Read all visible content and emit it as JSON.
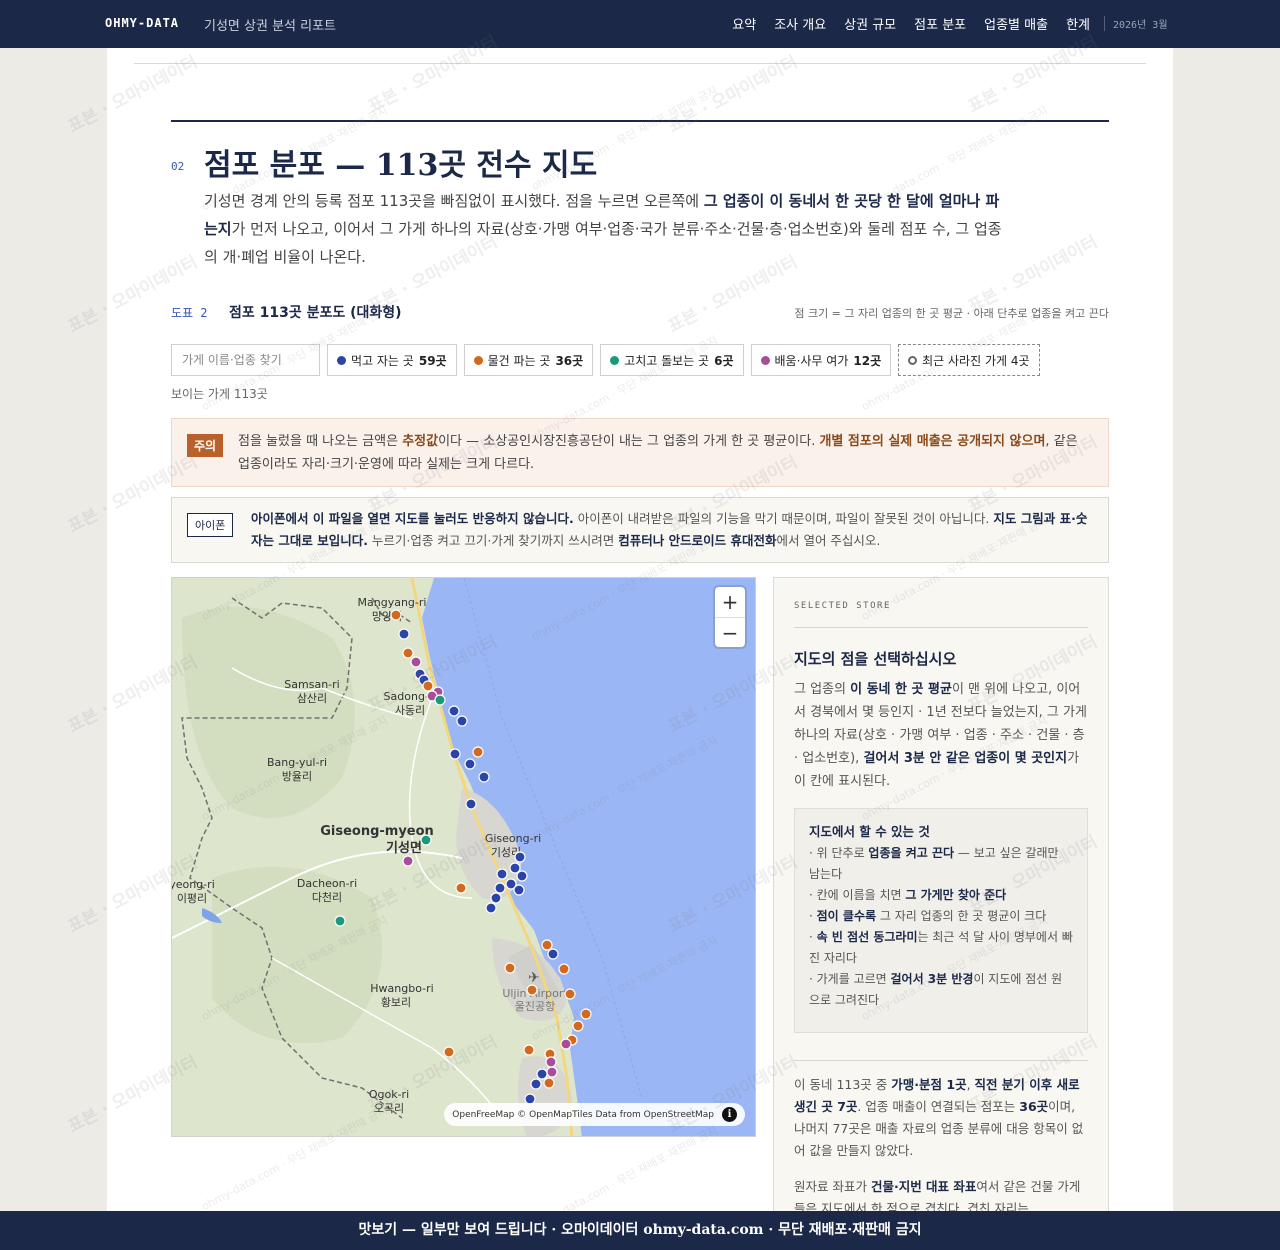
{
  "header": {
    "brand": "OHMY-DATA",
    "subtitle": "기성면 상권 분석 리포트",
    "nav": [
      "요약",
      "조사 개요",
      "상권 규모",
      "점포 분포",
      "업종별 매출",
      "한계"
    ],
    "date": "2026년 3월"
  },
  "section": {
    "number": "02",
    "title": "점포 분포 — 113곳 전수 지도",
    "lead_1": "기성면 경계 안의 등록 점포 113곳을 빠짐없이 표시했다. 점을 누르면 오른쪽에 ",
    "lead_b1": "그 업종이 이 동네서 한 곳당 한 달에 얼마나 파는지",
    "lead_2": "가 먼저 나오고, 이어서 그 가게 하나의 자료(상호·가맹 여부·업종·국가 분류·주소·건물·층·업소번호)와 둘레 점포 수, 그 업종의 개·폐업 비율이 나온다."
  },
  "figure": {
    "label": "도표 2",
    "title": "점포 113곳 분포도 (대화형)",
    "note": "점 크기 = 그 자리 업종의 한 곳 평균 · 아래 단추로 업종을 켜고 끈다",
    "search_placeholder": "가게 이름·업종 찾기",
    "filters": [
      {
        "label": "먹고 자는 곳",
        "count": "59곳",
        "color": "#2b44a8"
      },
      {
        "label": "물건 파는 곳",
        "count": "36곳",
        "color": "#d2691e"
      },
      {
        "label": "고치고 돌보는 곳",
        "count": "6곳",
        "color": "#1a9a7a"
      },
      {
        "label": "배움·사무 여가",
        "count": "12곳",
        "color": "#a64d9c"
      }
    ],
    "closed_filter": "최근 사라진 가게 4곳",
    "visible_count": "보이는 가게 113곳"
  },
  "caution": {
    "tag": "주의",
    "t1": "점을 눌렀을 때 나오는 금액은 ",
    "b1": "추정값",
    "t2": "이다 — 소상공인시장진흥공단이 내는 그 업종의 가게 한 곳 평균이다. ",
    "b2": "개별 점포의 실제 매출은 공개되지 않으며",
    "t3": ", 같은 업종이라도 자리·크기·운영에 따라 실제는 크게 다르다."
  },
  "iphone": {
    "tag": "아이폰",
    "b1": "아이폰에서 이 파일을 열면 지도를 눌러도 반응하지 않습니다.",
    "t1": " 아이폰이 내려받은 파일의 기능을 막기 때문이며, 파일이 잘못된 것이 아닙니다. ",
    "b2": "지도 그림과 표·숫자는 그대로 보입니다.",
    "t2": " 누르기·업종 켜고 끄기·가게 찾기까지 쓰시려면 ",
    "b3": "컴퓨터나 안드로이드 휴대전화",
    "t3": "에서 열어 주십시오."
  },
  "map": {
    "zoom_in": "+",
    "zoom_out": "−",
    "attribution": "OpenFreeMap © OpenMapTiles Data from OpenStreetMap",
    "labels": [
      {
        "en": "Mangyang-ri",
        "ko": "망양리"
      },
      {
        "en": "Samsan-ri",
        "ko": "삼산리"
      },
      {
        "en": "Sadong-ri",
        "ko": "사동리"
      },
      {
        "en": "Bang-yul-ri",
        "ko": "방율리"
      },
      {
        "en": "Giseong-myeon",
        "ko": "기성면"
      },
      {
        "en": "Giseong-ri",
        "ko": "기성리"
      },
      {
        "en": "Dacheon-ri",
        "ko": "다천리"
      },
      {
        "en": "yeong-ri",
        "ko": "이평리"
      },
      {
        "en": "Hwangbo-ri",
        "ko": "황보리"
      },
      {
        "en": "Uljin Airport",
        "ko": "울진공항"
      },
      {
        "en": "Ogok-ri",
        "ko": "오곡리"
      }
    ]
  },
  "panel": {
    "kicker": "SELECTED STORE",
    "title": "지도의 점을 선택하십시오",
    "d1": "그 업종의 ",
    "d_b1": "이 동네 한 곳 평균",
    "d2": "이 맨 위에 나오고, 이어서 경북에서 몇 등인지 · 1년 전보다 늘었는지, 그 가게 하나의 자료(상호 · 가맹 여부 · 업종 · 주소 · 건물 · 층 · 업소번호), ",
    "d_b2": "걸어서 3분 안 같은 업종이 몇 곳인지",
    "d3": "가 이 칸에 표시된다.",
    "howto_title": "지도에서 할 수 있는 것",
    "h1a": "· 위 단추로 ",
    "h1b": "업종을 켜고 끈다",
    "h1c": " — 보고 싶은 갈래만 남는다",
    "h2a": "· 칸에 이름을 치면 ",
    "h2b": "그 가게만 찾아 준다",
    "h3a": "· ",
    "h3b": "점이 클수록",
    "h3c": " 그 자리 업종의 한 곳 평균이 크다",
    "h4a": "· ",
    "h4b": "속 빈 점선 동그라미",
    "h4c": "는 최근 석 달 사이 명부에서 빠진 자리다",
    "h5a": "· 가게를 고르면 ",
    "h5b": "걸어서 3분 반경",
    "h5c": "이 지도에 점선 원으로 그려진다",
    "n1": "이 동네 113곳 중 ",
    "n_b1": "가맹·분점 1곳",
    "n2": ", ",
    "n_b2": "직전 분기 이후 새로 생긴 곳 7곳",
    "n3": ". 업종 매출이 연결되는 점포는 ",
    "n_b3": "36곳",
    "n4": "이며, 나머지 77곳은 매출 자료의 업종 분류에 대응 항목이 없어 값을 만들지 않았다.",
    "m1": "원자료 좌표가 ",
    "m_b1": "건물·지번 대표 좌표",
    "m2": "여서 같은 건물 가게들은 지도에서 한 점으로 겹친다. 겹친 자리는"
  },
  "watermark": {
    "main": "표본 · 오마이데이터",
    "small": "ohmy-data.com · 무단 재배포·재판매 금지"
  },
  "banner": "맛보기 — 일부만 보여 드립니다 · 오마이데이터 ohmy-data.com · 무단 재배포·재판매 금지",
  "colors": {
    "navy": "#1b2847",
    "food": "#2b44a8",
    "retail": "#d2691e",
    "repair": "#1a9a7a",
    "office": "#a64d9c",
    "sea": "#9bb6f4"
  }
}
